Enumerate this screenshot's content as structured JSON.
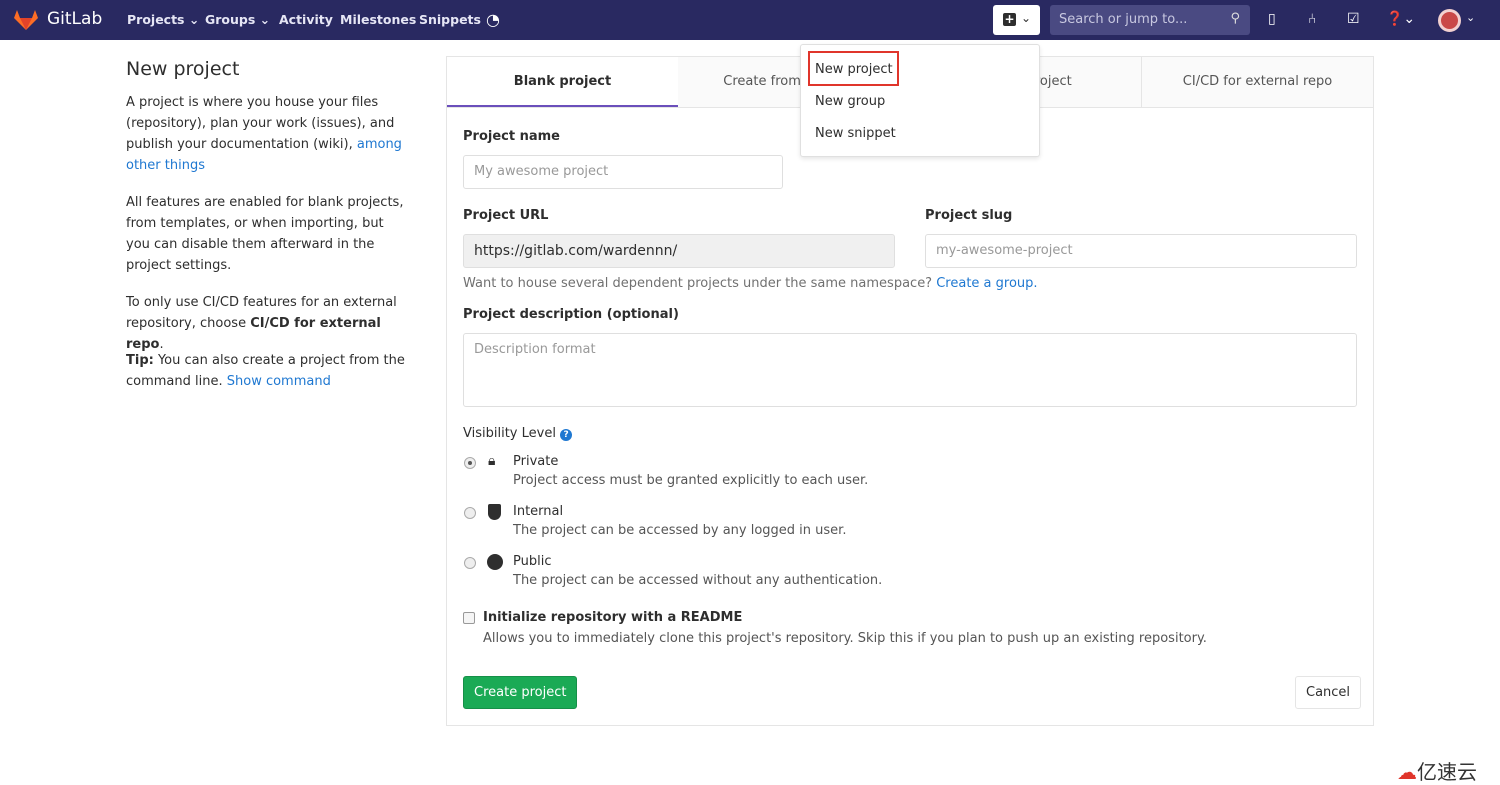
{
  "nav": {
    "brand": "GitLab",
    "links": [
      "Projects",
      "Groups",
      "Activity",
      "Milestones",
      "Snippets"
    ],
    "search_placeholder": "Search or jump to...",
    "colors": {
      "bar": "#292961"
    }
  },
  "dropdown": {
    "items": [
      "New project",
      "New group",
      "New snippet"
    ],
    "highlighted": "New project"
  },
  "sidebar": {
    "title": "New project",
    "p1_text": "A project is where you house your files (repository), plan your work (issues), and publish your documentation (wiki), ",
    "p1_link": "among other things",
    "p2": "All features are enabled for blank projects, from templates, or when importing, but you can disable them afterward in the project settings.",
    "p3_text": "To only use CI/CD features for an external repository, choose ",
    "p3_bold": "CI/CD for external repo",
    "tip_bold": "Tip:",
    "tip_text": " You can also create a project from the command line. ",
    "tip_link": "Show command"
  },
  "tabs": [
    "Blank project",
    "Create from template",
    "Import project",
    "CI/CD for external repo"
  ],
  "form": {
    "name_label": "Project name",
    "name_placeholder": "My awesome project",
    "url_label": "Project URL",
    "url_value": "https://gitlab.com/wardennn/",
    "slug_label": "Project slug",
    "slug_placeholder": "my-awesome-project",
    "group_help": "Want to house several dependent projects under the same namespace? ",
    "group_link": "Create a group.",
    "desc_label": "Project description (optional)",
    "desc_placeholder": "Description format",
    "visibility_label": "Visibility Level",
    "visibility": [
      {
        "title": "Private",
        "desc": "Project access must be granted explicitly to each user.",
        "icon": "lock-icon",
        "selected": true
      },
      {
        "title": "Internal",
        "desc": "The project can be accessed by any logged in user.",
        "icon": "shield-icon",
        "selected": false
      },
      {
        "title": "Public",
        "desc": "The project can be accessed without any authentication.",
        "icon": "globe-icon",
        "selected": false
      }
    ],
    "readme_label": "Initialize repository with a README",
    "readme_checked": false,
    "readme_help": "Allows you to immediately clone this project's repository. Skip this if you plan to push up an existing repository.",
    "create": "Create project",
    "cancel": "Cancel"
  },
  "watermark": "亿速云"
}
